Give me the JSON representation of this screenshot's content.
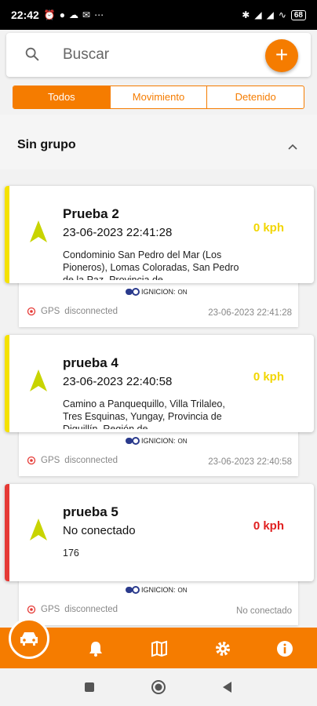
{
  "status_bar": {
    "time": "22:42",
    "battery": "68",
    "left_icons": [
      "alarm-icon",
      "messenger-icon",
      "cloud-icon",
      "mail-icon",
      "more-icon"
    ],
    "right_icons": [
      "bluetooth-icon",
      "signal-icon",
      "signal-icon",
      "wifi-icon",
      "battery-icon"
    ]
  },
  "search": {
    "placeholder": "Buscar",
    "add_label": "+"
  },
  "tabs": [
    {
      "label": "Todos",
      "active": true
    },
    {
      "label": "Movimiento",
      "active": false
    },
    {
      "label": "Detenido",
      "active": false
    }
  ],
  "group": {
    "title": "Sin grupo"
  },
  "vehicles": [
    {
      "name": "Prueba 2",
      "date": "23-06-2023 22:41:28",
      "address": "Condominio San Pedro del Mar (Los Pioneros), Lomas Coloradas, San Pedro de la Paz, Provincia de",
      "speed": "0 kph",
      "bar_color": "#f5e200",
      "speed_color": "#f2d600",
      "ignition_label": "IGNICION:",
      "ignition_value": "ON",
      "gps_label": "GPS",
      "gps_status": "disconnected",
      "timestamp": "23-06-2023 22:41:28"
    },
    {
      "name": "prueba 4",
      "date": "23-06-2023 22:40:58",
      "address": "Camino a Panquequillo, Villa Trilaleo, Tres Esquinas, Yungay, Provincia de Diguillín, Región de",
      "speed": "0 kph",
      "bar_color": "#f5e200",
      "speed_color": "#f2d600",
      "ignition_label": "IGNICION:",
      "ignition_value": "ON",
      "gps_label": "GPS",
      "gps_status": "disconnected",
      "timestamp": "23-06-2023 22:40:58"
    },
    {
      "name": "prueba 5",
      "date": "No conectado",
      "address": "176",
      "speed": "0 kph",
      "bar_color": "#e53935",
      "speed_color": "#e02020",
      "ignition_label": "IGNICION:",
      "ignition_value": "ON",
      "gps_label": "GPS",
      "gps_status": "disconnected",
      "timestamp": "No conectado"
    }
  ],
  "colors": {
    "accent": "#f57c00",
    "vehicle_arrow": "#c8d400"
  },
  "bottom_nav": {
    "items": [
      "car-icon",
      "bell-icon",
      "map-icon",
      "gear-icon",
      "info-icon"
    ],
    "active": "car-icon"
  },
  "system_nav": [
    "recents-button",
    "home-button",
    "back-button"
  ]
}
